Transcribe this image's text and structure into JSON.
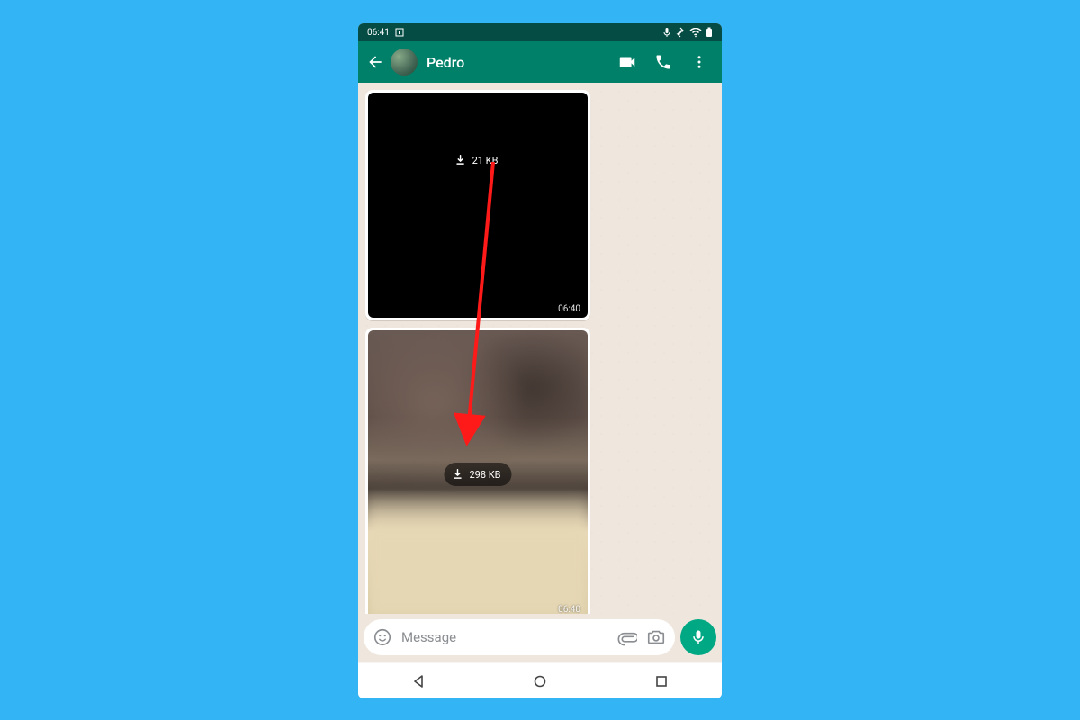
{
  "statusbar": {
    "time": "06:41"
  },
  "header": {
    "contact_name": "Pedro"
  },
  "messages": [
    {
      "size": "21 KB",
      "time": "06:40"
    },
    {
      "size": "298 KB",
      "time": "06:40"
    }
  ],
  "composer": {
    "placeholder": "Message"
  }
}
